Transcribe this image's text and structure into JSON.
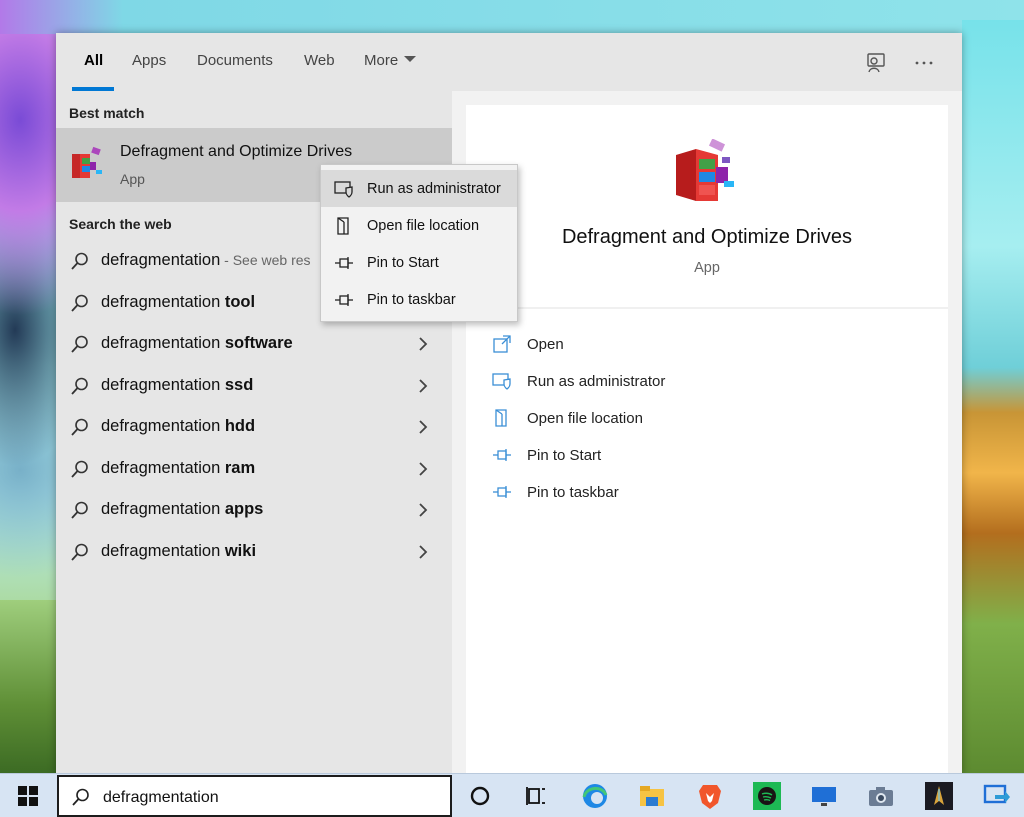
{
  "tabs": [
    "All",
    "Apps",
    "Documents",
    "Web",
    "More"
  ],
  "sections": {
    "best_match": "Best match",
    "search_web": "Search the web"
  },
  "best_match": {
    "title": "Defragment and Optimize Drives",
    "type": "App"
  },
  "web_results": [
    {
      "prefix": "defragmentation",
      "bold": "",
      "hint": " - See web res"
    },
    {
      "prefix": "defragmentation ",
      "bold": "tool",
      "hint": ""
    },
    {
      "prefix": "defragmentation ",
      "bold": "software",
      "hint": ""
    },
    {
      "prefix": "defragmentation ",
      "bold": "ssd",
      "hint": ""
    },
    {
      "prefix": "defragmentation ",
      "bold": "hdd",
      "hint": ""
    },
    {
      "prefix": "defragmentation ",
      "bold": "ram",
      "hint": ""
    },
    {
      "prefix": "defragmentation ",
      "bold": "apps",
      "hint": ""
    },
    {
      "prefix": "defragmentation ",
      "bold": "wiki",
      "hint": ""
    }
  ],
  "preview": {
    "title": "Defragment and Optimize Drives",
    "type": "App",
    "actions": [
      "Open",
      "Run as administrator",
      "Open file location",
      "Pin to Start",
      "Pin to taskbar"
    ]
  },
  "context_menu": [
    "Run as administrator",
    "Open file location",
    "Pin to Start",
    "Pin to taskbar"
  ],
  "search_query": "defragmentation",
  "taskbar_icons": [
    "cortana-circle-icon",
    "task-view-icon",
    "edge-icon",
    "file-explorer-icon",
    "brave-icon",
    "spotify-icon",
    "monitor-icon",
    "camera-icon",
    "game-icon",
    "remote-app-icon"
  ],
  "colors": {
    "accent": "#0078d4",
    "panel_bg": "#f2f2f2",
    "left_bg": "#e6e6e6",
    "best_match_bg": "#cbcbcb"
  }
}
